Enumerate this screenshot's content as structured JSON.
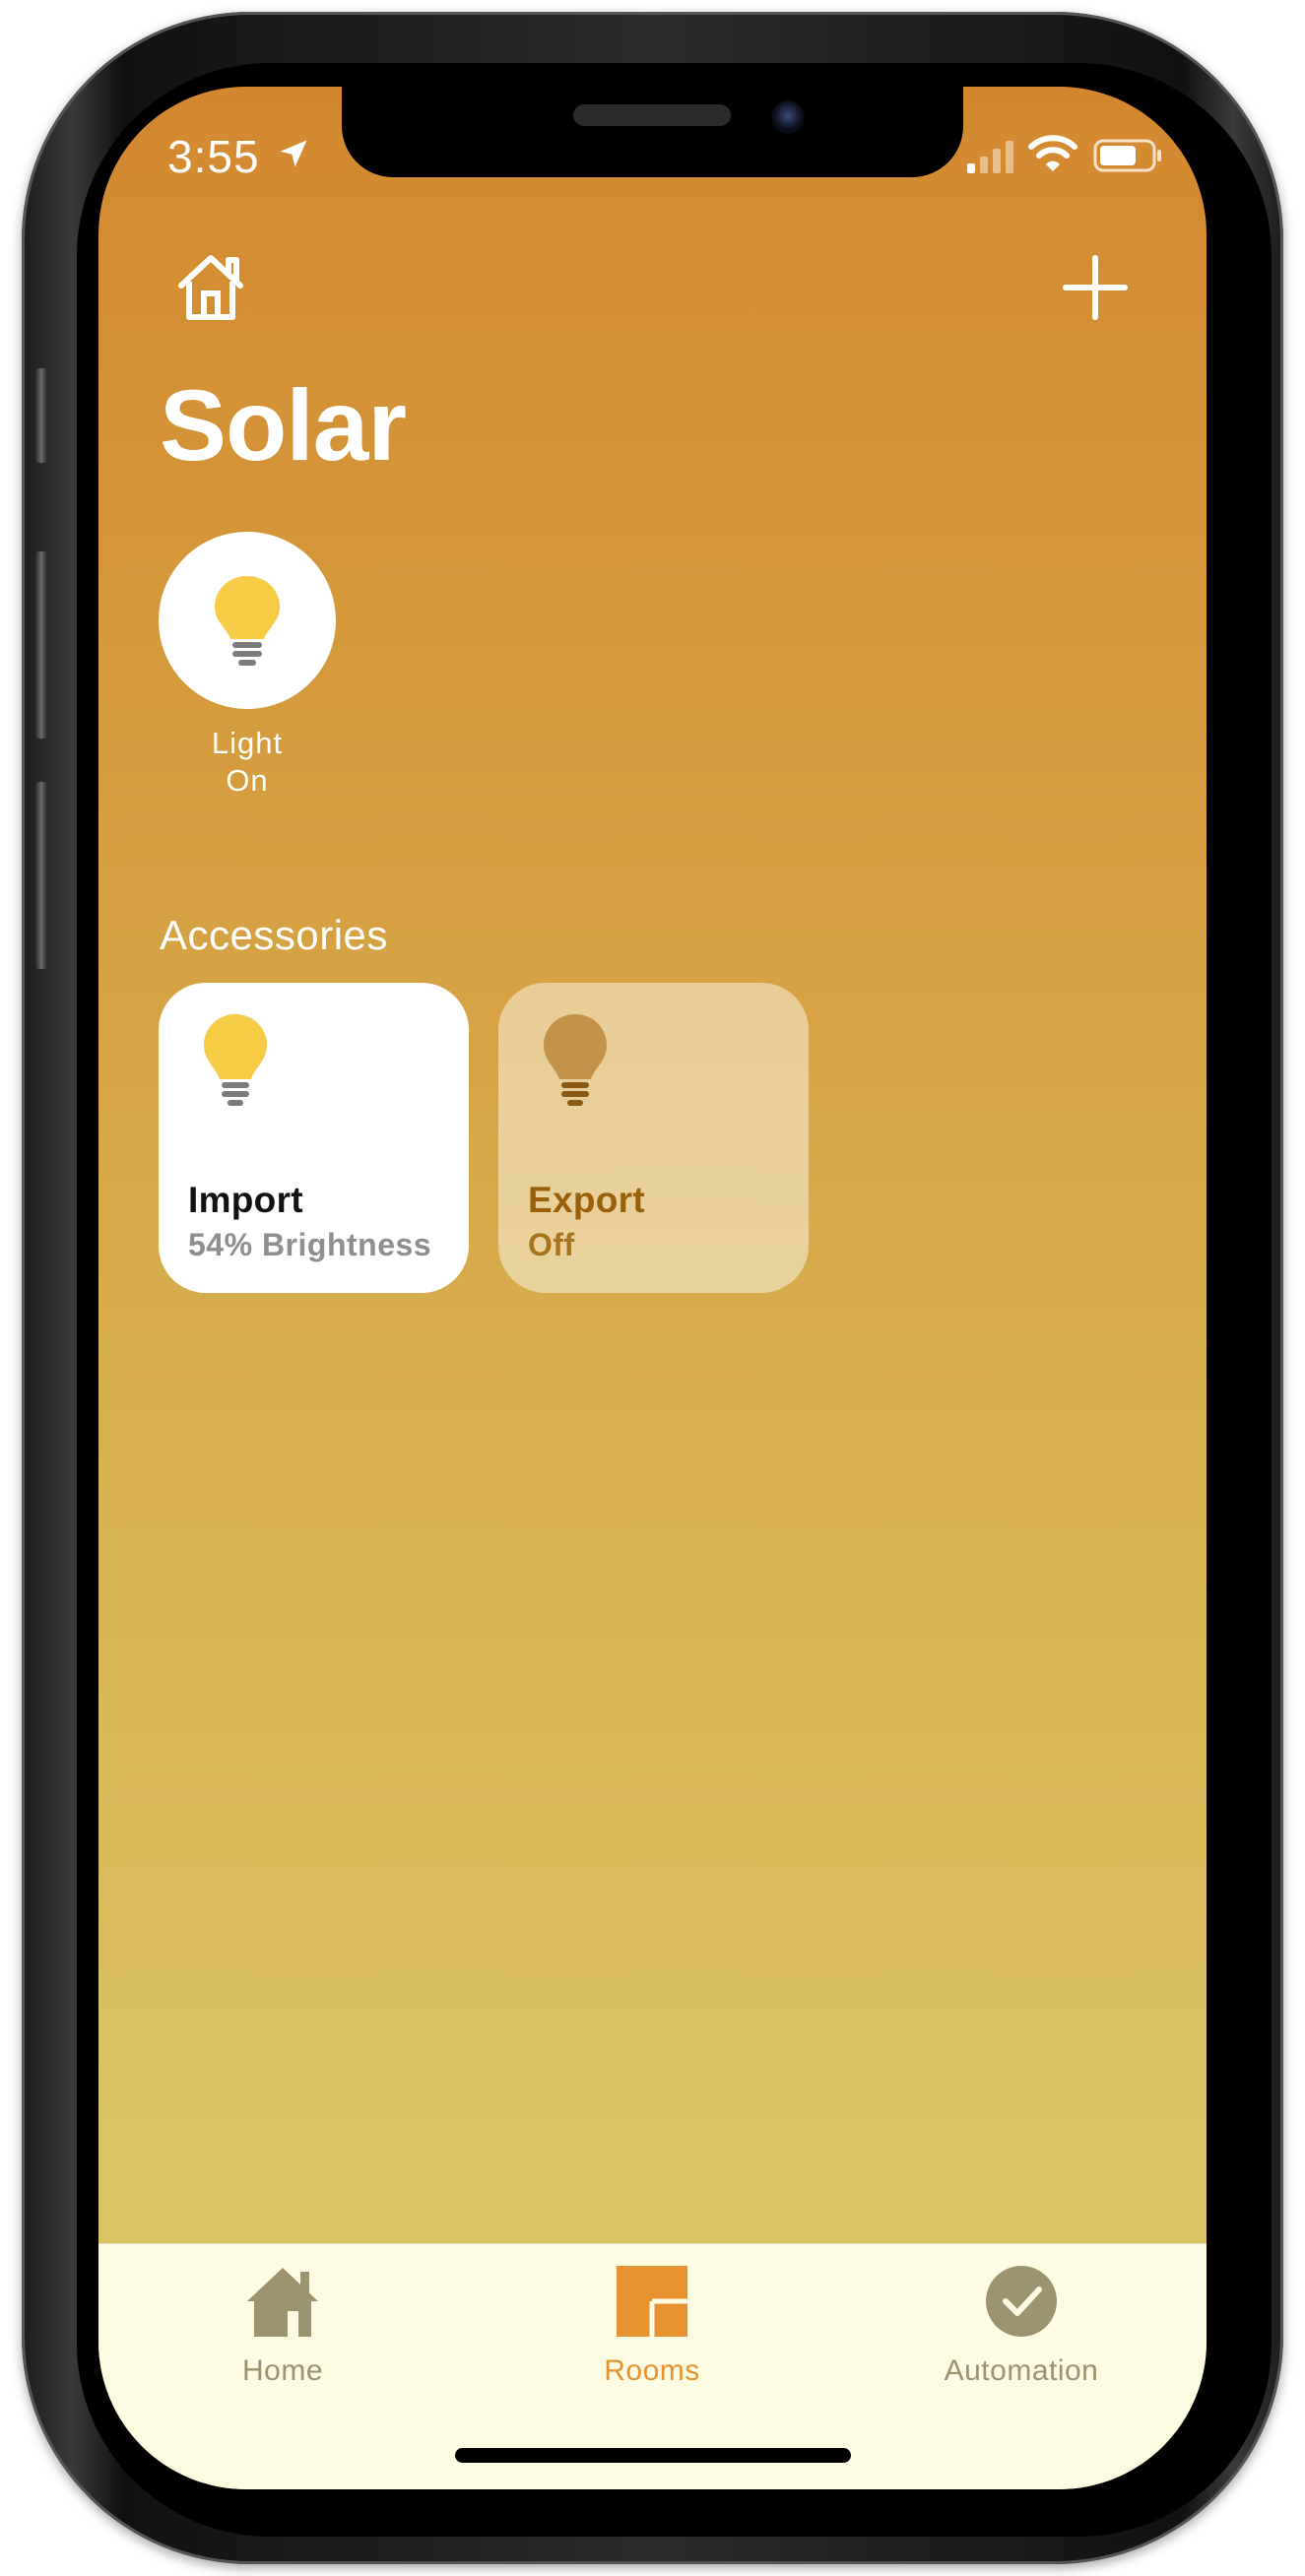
{
  "status_bar": {
    "time": "3:55"
  },
  "header": {
    "title": "Solar"
  },
  "scene": {
    "label_line1": "Light",
    "label_line2": "On"
  },
  "accessories": {
    "section_title": "Accessories",
    "tiles": [
      {
        "name": "Import",
        "status": "54% Brightness",
        "state": "on",
        "icon": "lightbulb-icon"
      },
      {
        "name": "Export",
        "status": "Off",
        "state": "off",
        "icon": "lightbulb-icon"
      }
    ]
  },
  "tab_bar": {
    "items": [
      {
        "label": "Home",
        "icon": "house-icon",
        "selected": false
      },
      {
        "label": "Rooms",
        "icon": "rooms-icon",
        "selected": true
      },
      {
        "label": "Automation",
        "icon": "clock-check-icon",
        "selected": false
      }
    ]
  },
  "colors": {
    "background_top": "#d3882f",
    "background_bottom": "#dcc96a",
    "bulb_on": "#f6cb45",
    "bulb_off": "#c2914a",
    "tab_selected": "#e6922e",
    "tab_unselected": "#9b946f",
    "tab_bar_bg": "#fdfbe1"
  }
}
